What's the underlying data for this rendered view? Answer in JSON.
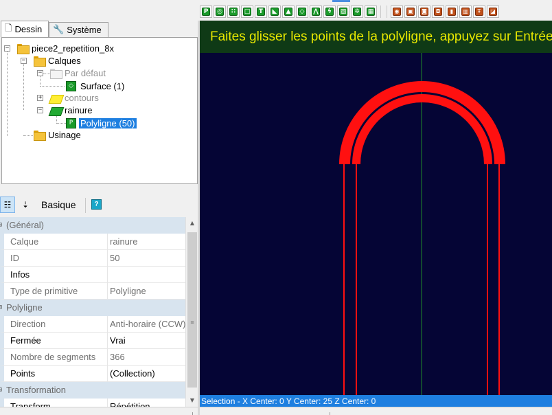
{
  "tabs": [
    {
      "label": "Dessin",
      "icon": "document-icon"
    },
    {
      "label": "Système",
      "icon": "wrench-icon"
    }
  ],
  "tree": {
    "root": "piece2_repetition_8x",
    "calques": "Calques",
    "par_defaut": "Par défaut",
    "surface": "Surface (1)",
    "contours": "contours",
    "rainure": "rainure",
    "polyligne": "Polyligne (50)",
    "usinage": "Usinage"
  },
  "property_toolbar": {
    "categorized_icon": "categorized-icon",
    "alphabetical_icon": "sort-az-icon",
    "basic_label": "Basique",
    "help_glyph": "?"
  },
  "property_grid": {
    "general": {
      "title": "(Général)",
      "rows": [
        {
          "name": "Calque",
          "value": "rainure"
        },
        {
          "name": "ID",
          "value": "50"
        },
        {
          "name": "Infos",
          "value": ""
        },
        {
          "name": "Type de primitive",
          "value": "Polyligne"
        }
      ]
    },
    "polyligne": {
      "title": "Polyligne",
      "rows": [
        {
          "name": "Direction",
          "value": "Anti-horaire (CCW)"
        },
        {
          "name": "Fermée",
          "value": "Vrai"
        },
        {
          "name": "Nombre de segments",
          "value": "366"
        },
        {
          "name": "Points",
          "value": "(Collection)"
        }
      ]
    },
    "transformation": {
      "title": "Transformation",
      "rows": [
        {
          "name": "Transform",
          "value": "Répétition"
        }
      ]
    }
  },
  "canvas": {
    "banner_text": "Faites glisser les points de la polyligne, appuyez sur Entrée",
    "background": "#050535",
    "shape_color": "#ff1010",
    "axis_color": "#1f8a2a"
  },
  "status_bar": {
    "text": "Selection - X Center: 0  Y Center: 25  Z Center: 0"
  },
  "colors": {
    "selection": "#1e7fe0",
    "banner_bg": "#0f3a16",
    "banner_text": "#e8e800"
  }
}
